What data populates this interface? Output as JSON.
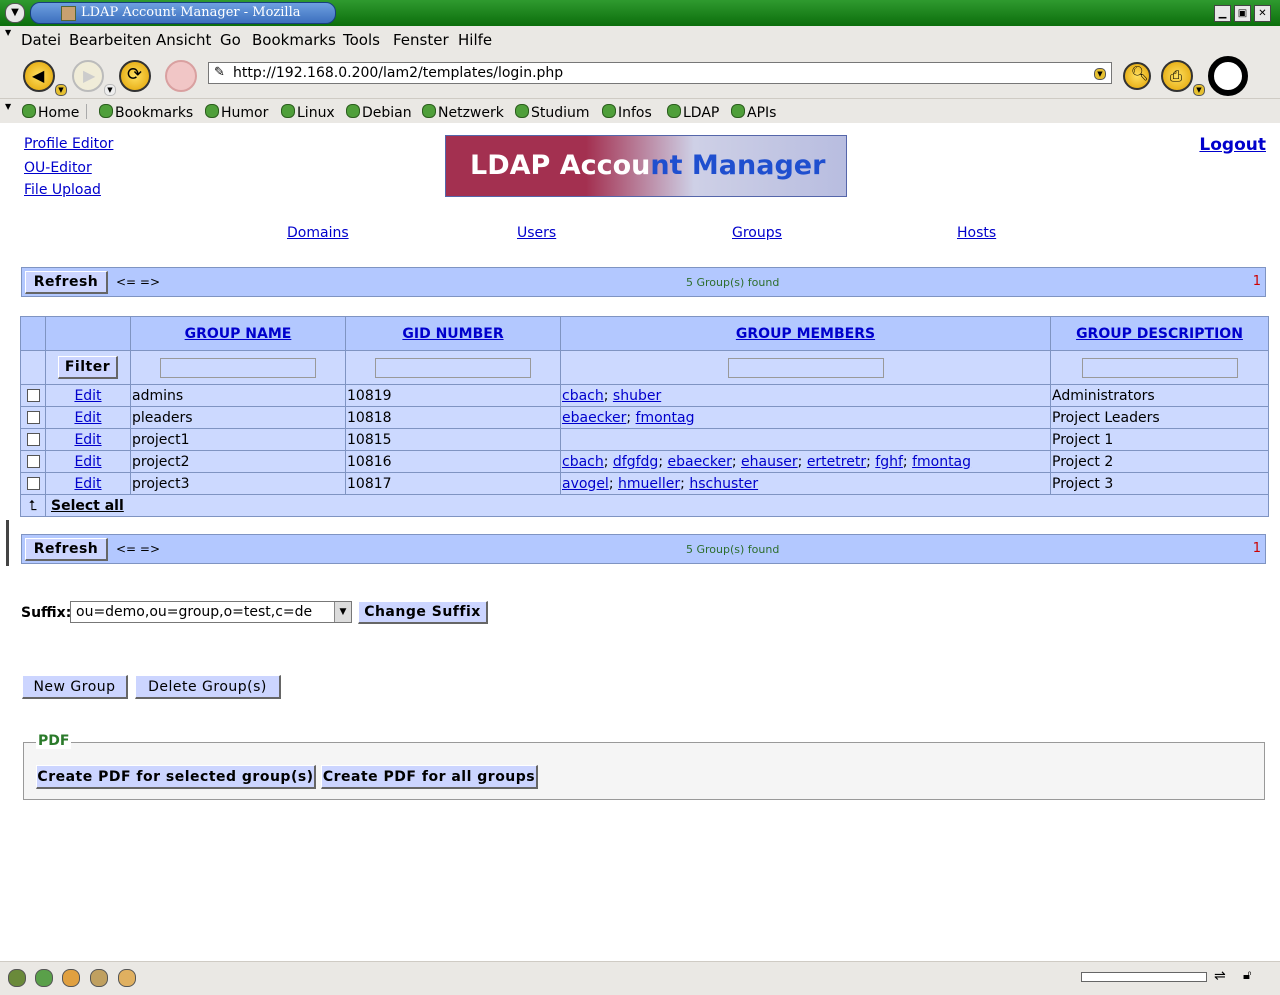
{
  "window": {
    "title": "LDAP Account Manager - Mozilla",
    "menu_icon": "window-menu-icon",
    "controls": [
      "minimize-icon",
      "maximize-icon",
      "close-icon"
    ]
  },
  "menubar": {
    "items": [
      "Datei",
      "Bearbeiten",
      "Ansicht",
      "Go",
      "Bookmarks",
      "Tools",
      "Fenster",
      "Hilfe"
    ]
  },
  "navbar": {
    "url": "http://192.168.0.200/lam2/templates/login.php",
    "icons": [
      "back-icon",
      "forward-icon",
      "reload-icon",
      "stop-icon",
      "search-icon",
      "print-icon",
      "throbber-icon"
    ]
  },
  "bookmarks": {
    "items": [
      "Home",
      "Bookmarks",
      "Humor",
      "Linux",
      "Debian",
      "Netzwerk",
      "Studium",
      "Infos",
      "LDAP",
      "APIs"
    ]
  },
  "page": {
    "left_links": [
      "Profile Editor",
      "OU-Editor",
      "File Upload"
    ],
    "logo": {
      "part1": "LDAP Accou",
      "part2": "nt Manager"
    },
    "logout": "Logout",
    "tabs": [
      "Domains",
      "Users",
      "Groups",
      "Hosts"
    ],
    "bar": {
      "refresh": "Refresh",
      "arrows": "<= =>",
      "found": "5 Group(s) found",
      "page": "1"
    },
    "table": {
      "headers": [
        "GROUP NAME",
        "GID NUMBER",
        "GROUP MEMBERS",
        "GROUP DESCRIPTION"
      ],
      "filter": "Filter",
      "edit": "Edit",
      "select_all": "Select all",
      "rows": [
        {
          "name": "admins",
          "gid": "10819",
          "members": [
            "cbach",
            "shuber"
          ],
          "desc": "Administrators"
        },
        {
          "name": "pleaders",
          "gid": "10818",
          "members": [
            "ebaecker",
            "fmontag"
          ],
          "desc": "Project Leaders"
        },
        {
          "name": "project1",
          "gid": "10815",
          "members": [],
          "desc": "Project 1"
        },
        {
          "name": "project2",
          "gid": "10816",
          "members": [
            "cbach",
            "dfgfdg",
            "ebaecker",
            "ehauser",
            "ertetretr",
            "fghf",
            "fmontag"
          ],
          "desc": "Project 2"
        },
        {
          "name": "project3",
          "gid": "10817",
          "members": [
            "avogel",
            "hmueller",
            "hschuster"
          ],
          "desc": "Project 3"
        }
      ]
    },
    "suffix": {
      "label": "Suffix:",
      "value": "ou=demo,ou=group,o=test,c=de",
      "button": "Change Suffix"
    },
    "actions": {
      "new": "New Group",
      "delete": "Delete Group(s)"
    },
    "pdf": {
      "legend": "PDF",
      "selected": "Create PDF for selected group(s)",
      "all": "Create PDF for all groups"
    }
  },
  "colors": {
    "titlebar": "#0c6e0c",
    "bar": "#b3c8ff",
    "row": "#ccd9ff",
    "button": "#ccd5ff",
    "found_text": "#2e6e2e",
    "page_number": "#cc0000",
    "pdf_legend": "#2a7a2a"
  }
}
